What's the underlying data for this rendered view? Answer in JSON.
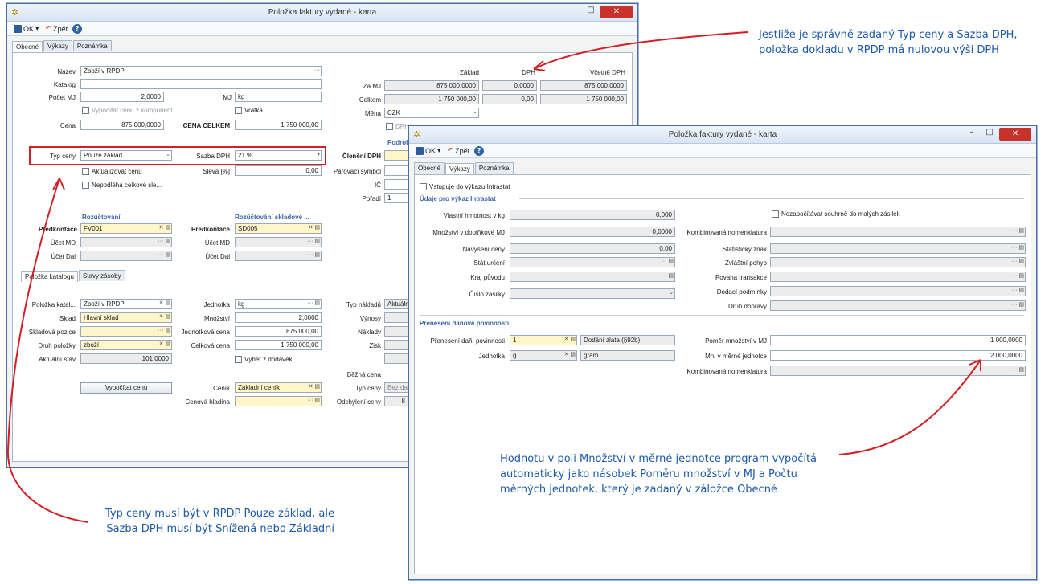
{
  "window1": {
    "title": "Položka faktury vydané - karta",
    "toolbar": {
      "ok": "OK",
      "back": "Zpět",
      "help": "?"
    },
    "tabs": [
      "Obecné",
      "Výkazy",
      "Poznámka"
    ],
    "labels": {
      "nazev": "Název",
      "katalog": "Katalog",
      "pocet_mj": "Počet MJ",
      "mj": "MJ",
      "cena": "Cena",
      "cena_celkem": "CENA CELKEM",
      "typ_ceny": "Typ ceny",
      "sazba_dph": "Sazba DPH",
      "sleva": "Sleva [%]",
      "parovaci": "Párovací symbol",
      "ic": "IČ",
      "poradi": "Pořadí",
      "clenenidph": "Členění DPH",
      "podrob": "Podrob",
      "zaklad": "Základ",
      "dph": "DPH",
      "vcetne": "Včetně DPH",
      "za_mj": "Za MJ",
      "celkem": "Celkem",
      "mena": "Měna",
      "rozuctovani": "Rozúčtování",
      "rozuct_sklad": "Rozúčtování skladové ...",
      "predkontace": "Předkontace",
      "ucet_md": "Účet MD",
      "ucet_dal": "Účet Dal"
    },
    "values": {
      "nazev": "Zboží v RPDP",
      "pocet_mj": "2,0000",
      "mj": "kg",
      "cena": "875 000,0000",
      "cena_celkem": "1 750 000,00",
      "typ_ceny": "Pouze základ",
      "sazba_dph": "21 %",
      "sleva": "0,00",
      "poradi": "1",
      "za_mj_zaklad": "875 000,0000",
      "za_mj_dph": "0,0000",
      "za_mj_vcetne": "875 000,0000",
      "celkem_zaklad": "1 750 000,00",
      "celkem_dph": "0,00",
      "celkem_vcetne": "1 750 000,00",
      "mena": "CZK",
      "predkontace1": "FV001",
      "predkontace2": "SD005"
    },
    "checks": {
      "vypocitat": "Vypočítat cenu z komponent",
      "vratka": "Vratka",
      "dph_chk": "DPH",
      "aktualizovat": "Aktualizovat cenu",
      "nepodleha": "Nepodléhá celkové sle..."
    },
    "subtabs": [
      "Položka katalogu",
      "Stavy zásoby"
    ],
    "sub": {
      "polozka_kat_lbl": "Položka katal...",
      "polozka_kat_val": "Zboží v RPDP",
      "sklad_lbl": "Sklad",
      "sklad_val": "Hlavní sklad",
      "skl_pozice_lbl": "Skladová pozice",
      "druh_lbl": "Druh položky",
      "druh_val": "zboží",
      "akt_stav_lbl": "Aktuální stav",
      "akt_stav_val": "101,0000",
      "vypocitat_btn": "Vypočítat cenu",
      "jednotka_lbl": "Jednotka",
      "jednotka_val": "kg",
      "mnozstvi_lbl": "Množství",
      "mnozstvi_val": "2,0000",
      "jedn_cena_lbl": "Jednotková cena",
      "jedn_cena_val": "875 000,00",
      "celk_cena_lbl": "Celková cena",
      "celk_cena_val": "1 750 000,00",
      "vyber": "Výběr z dodávek",
      "cenik_lbl": "Ceník",
      "cenik_val": "Základní ceník",
      "cen_hladina_lbl": "Cenová hladina",
      "typ_nakladu_lbl": "Typ nákladů",
      "typ_nakladu_val": "Aktuáln",
      "vynosy_lbl": "Výnosy",
      "naklady_lbl": "Náklady",
      "zisk_lbl": "Zisk",
      "bezna_cena_lbl": "Běžná cena",
      "typ_ceny_lbl": "Typ ceny",
      "typ_ceny_val": "Bez da",
      "odchyleni_lbl": "Odchýlení ceny",
      "odchyleni_val": "8"
    }
  },
  "window2": {
    "title": "Položka faktury vydané - karta",
    "toolbar": {
      "ok": "OK",
      "back": "Zpět",
      "help": "?"
    },
    "tabs": [
      "Obecné",
      "Výkazy",
      "Poznámka"
    ],
    "vstupuje": "Vstupuje do výkazu Intrastat",
    "sect_intrastat": "Údaje pro výkaz Intrastat",
    "vlastni_lbl": "Vlastní hmotnost v kg",
    "vlastni_val": "0,000",
    "mnozstvi_dopl_lbl": "Množství v doplňkové MJ",
    "mnozstvi_dopl_val": "0,0000",
    "navyseni_lbl": "Navýšení ceny",
    "navyseni_val": "0,00",
    "stat_lbl": "Stát určení",
    "kraj_lbl": "Kraj původu",
    "cislo_lbl": "Číslo zásilky",
    "nezapocitavat": "Nezapočítávat souhrně do malých zásilek",
    "komb_lbl": "Kombinovaná nomenklatura",
    "stat_znak_lbl": "Statistický znak",
    "zvl_pohyb_lbl": "Zvláštní pohyb",
    "povaha_lbl": "Povaha transakce",
    "dodaci_lbl": "Dodací podmínky",
    "druh_dopravy_lbl": "Druh dopravy",
    "sect_prenes": "Přenesení daňové povinnosti",
    "prenes_lbl": "Přenesení daň. povinnosti",
    "prenes_val": "1",
    "prenes_desc": "Dodání zlata (§92b)",
    "jednotka_lbl": "Jednotka",
    "jednotka_val": "g",
    "jednotka_desc": "gram",
    "pomer_lbl": "Poměr množství v MJ",
    "pomer_val": "1 000,0000",
    "mn_merne_lbl": "Mn. v měrné jednotce",
    "mn_merne_val": "2 000,0000",
    "komb2_lbl": "Kombinovaná nomenklatura"
  },
  "callouts": {
    "top": "Jestliže je správně zadaný Typ ceny a Sazba DPH, položka dokladu v RPDP má nulovou výši DPH",
    "bottom_left": "Typ ceny musí být v RPDP Pouze základ, ale Sazba DPH musí být Snížená nebo Základní",
    "middle": "Hodnotu v poli Množství v měrné jednotce program vypočítá automaticky jako násobek Poměru množství v MJ a Počtu měrných jednotek, který je zadaný v záložce Obecné"
  },
  "colors": {
    "accent": "#1d5aa8",
    "highlight": "#d32027",
    "close": "#c9312b"
  }
}
